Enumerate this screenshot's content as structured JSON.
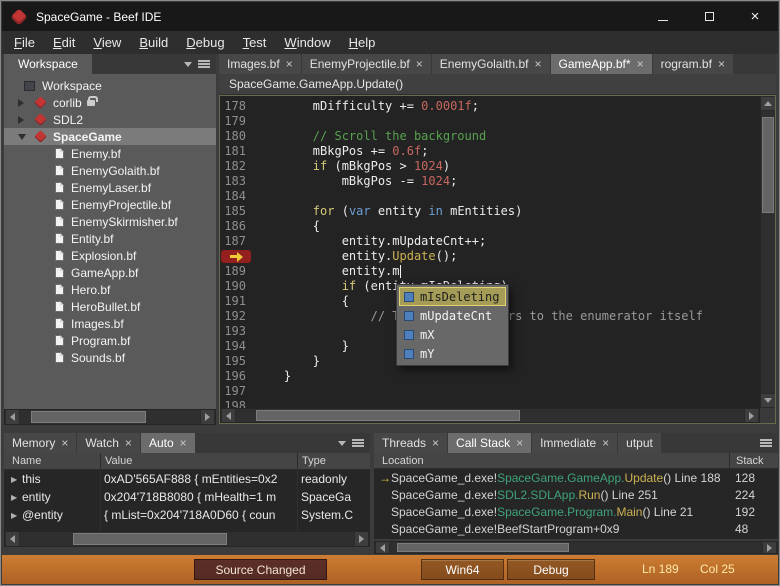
{
  "window": {
    "title": "SpaceGame - Beef IDE"
  },
  "menu": [
    "File",
    "Edit",
    "View",
    "Build",
    "Debug",
    "Test",
    "Window",
    "Help"
  ],
  "workspace": {
    "tab": "Workspace",
    "tree": [
      {
        "label": "Workspace",
        "icon": "workspace",
        "depth": 0
      },
      {
        "label": "corlib",
        "icon": "beef",
        "depth": 1,
        "arrow": "right",
        "lock": true
      },
      {
        "label": "SDL2",
        "icon": "beef",
        "depth": 1,
        "arrow": "right"
      },
      {
        "label": "SpaceGame",
        "icon": "beef",
        "depth": 1,
        "arrow": "down",
        "selected": true
      },
      {
        "label": "Enemy.bf",
        "icon": "file",
        "depth": 2
      },
      {
        "label": "EnemyGolaith.bf",
        "icon": "file",
        "depth": 2
      },
      {
        "label": "EnemyLaser.bf",
        "icon": "file",
        "depth": 2
      },
      {
        "label": "EnemyProjectile.bf",
        "icon": "file",
        "depth": 2
      },
      {
        "label": "EnemySkirmisher.bf",
        "icon": "file",
        "depth": 2
      },
      {
        "label": "Entity.bf",
        "icon": "file",
        "depth": 2
      },
      {
        "label": "Explosion.bf",
        "icon": "file",
        "depth": 2
      },
      {
        "label": "GameApp.bf",
        "icon": "file",
        "depth": 2
      },
      {
        "label": "Hero.bf",
        "icon": "file",
        "depth": 2
      },
      {
        "label": "HeroBullet.bf",
        "icon": "file",
        "depth": 2
      },
      {
        "label": "Images.bf",
        "icon": "file",
        "depth": 2
      },
      {
        "label": "Program.bf",
        "icon": "file",
        "depth": 2
      },
      {
        "label": "Sounds.bf",
        "icon": "file",
        "depth": 2
      }
    ]
  },
  "editor": {
    "tabs": [
      {
        "label": "Images.bf",
        "close": true
      },
      {
        "label": "EnemyProjectile.bf",
        "close": true
      },
      {
        "label": "EnemyGolaith.bf",
        "close": true
      },
      {
        "label": "GameApp.bf*",
        "close": true,
        "active": true
      },
      {
        "label": "rogram.bf",
        "close": true
      }
    ],
    "breadcrumb": "SpaceGame.GameApp.Update()",
    "ip_line": 188,
    "caret_line": 189,
    "lines": [
      {
        "num": 178,
        "segs": [
          [
            "p",
            "        mDifficulty += "
          ],
          [
            "n",
            "0.0001f"
          ],
          [
            "p",
            ";"
          ]
        ]
      },
      {
        "num": 179,
        "segs": []
      },
      {
        "num": 180,
        "segs": [
          [
            "c",
            "        // Scroll the background"
          ]
        ]
      },
      {
        "num": 181,
        "segs": [
          [
            "p",
            "        mBkgPos += "
          ],
          [
            "n",
            "0.6f"
          ],
          [
            "p",
            ";"
          ]
        ]
      },
      {
        "num": 182,
        "segs": [
          [
            "k",
            "        if"
          ],
          [
            "p",
            " (mBkgPos > "
          ],
          [
            "n",
            "1024"
          ],
          [
            "p",
            ")"
          ]
        ]
      },
      {
        "num": 183,
        "segs": [
          [
            "p",
            "            mBkgPos -= "
          ],
          [
            "n",
            "1024"
          ],
          [
            "p",
            ";"
          ]
        ]
      },
      {
        "num": 184,
        "segs": []
      },
      {
        "num": 185,
        "segs": [
          [
            "k",
            "        for"
          ],
          [
            "p",
            " ("
          ],
          [
            "t",
            "var"
          ],
          [
            "p",
            " entity "
          ],
          [
            "t",
            "in"
          ],
          [
            "p",
            " mEntities)"
          ]
        ]
      },
      {
        "num": 186,
        "segs": [
          [
            "p",
            "        {"
          ]
        ]
      },
      {
        "num": 187,
        "segs": [
          [
            "p",
            "            entity.mUpdateCnt++;"
          ]
        ]
      },
      {
        "num": 188,
        "segs": [
          [
            "p",
            "            entity."
          ],
          [
            "m",
            "Update"
          ],
          [
            "p",
            "();"
          ]
        ]
      },
      {
        "num": 189,
        "segs": [
          [
            "p",
            "            entity.m"
          ]
        ]
      },
      {
        "num": 190,
        "segs": [
          [
            "k",
            "            if"
          ],
          [
            "p",
            " (entity.mIsDeleting)"
          ]
        ]
      },
      {
        "num": 191,
        "segs": [
          [
            "p",
            "            {"
          ]
        ]
      },
      {
        "num": 192,
        "segs": [
          [
            "g",
            "                // The @entity refers to the enumerator itself"
          ]
        ]
      },
      {
        "num": 193,
        "segs": []
      },
      {
        "num": 194,
        "segs": [
          [
            "p",
            "            }"
          ]
        ]
      },
      {
        "num": 195,
        "segs": [
          [
            "p",
            "        }"
          ]
        ]
      },
      {
        "num": 196,
        "segs": [
          [
            "p",
            "    }"
          ]
        ]
      },
      {
        "num": 197,
        "segs": []
      },
      {
        "num": 198,
        "segs": []
      }
    ],
    "autocomplete": {
      "items": [
        {
          "label": "mIsDeleting",
          "selected": true
        },
        {
          "label": "mUpdateCnt"
        },
        {
          "label": "mX"
        },
        {
          "label": "mY"
        }
      ]
    }
  },
  "watch": {
    "tabs": [
      {
        "label": "Memory",
        "close": true
      },
      {
        "label": "Watch",
        "close": true
      },
      {
        "label": "Auto",
        "close": true,
        "active": true
      }
    ],
    "columns": [
      "Name",
      "Value",
      "Type"
    ],
    "rows": [
      {
        "name": "this",
        "value": "0xAD'565AF888 { mEntities=0x2",
        "type": "readonly"
      },
      {
        "name": "entity",
        "value": "0x204'718B8080 { mHealth=1 m",
        "type": "SpaceGa"
      },
      {
        "name": "@entity",
        "value": "{ mList=0x204'718A0D60 { coun",
        "type": "System.C"
      }
    ]
  },
  "callstack": {
    "tabs": [
      {
        "label": "Threads",
        "close": true
      },
      {
        "label": "Call Stack",
        "close": true,
        "active": true
      },
      {
        "label": "Immediate",
        "close": true
      },
      {
        "label": "utput",
        "close": false
      }
    ],
    "columns": [
      "Location",
      "Stack"
    ],
    "frames": [
      {
        "current": true,
        "loc": [
          [
            "p",
            "SpaceGame_d.exe!"
          ],
          [
            "ns",
            "SpaceGame.GameApp."
          ],
          [
            "fn",
            "Update"
          ],
          [
            "p",
            "() Line 188"
          ]
        ],
        "stack": "128"
      },
      {
        "loc": [
          [
            "p",
            "SpaceGame_d.exe!"
          ],
          [
            "ns",
            "SDL2.SDLApp."
          ],
          [
            "fn",
            "Run"
          ],
          [
            "p",
            "() Line 251"
          ]
        ],
        "stack": "224"
      },
      {
        "loc": [
          [
            "p",
            "SpaceGame_d.exe!"
          ],
          [
            "ns",
            "SpaceGame.Program."
          ],
          [
            "fn",
            "Main"
          ],
          [
            "p",
            "() Line 21"
          ]
        ],
        "stack": "192"
      },
      {
        "loc": [
          [
            "p",
            "SpaceGame_d.exe!BeefStartProgram+0x9"
          ]
        ],
        "stack": "48"
      }
    ]
  },
  "statusbar": {
    "source_changed": "Source Changed",
    "platform": "Win64",
    "config": "Debug",
    "line": "Ln 189",
    "col": "Col 25"
  },
  "colors": {
    "statusbar_orange": "#cd7d33",
    "statusbar_orange_dark": "#ad6124",
    "source_changed_bg": "#542b24",
    "keyword": "#d6c97a",
    "type_keyword": "#6f9fd6",
    "number": "#c7685f",
    "comment": "#57a24f",
    "method": "#cdb152",
    "ghost": "#9a9a9a",
    "callstack_ns": "#3fa379",
    "callstack_fn": "#cdb152",
    "ip_red": "#941f1f",
    "ip_yellow": "#eecb36",
    "selection_bg": "#a59d57",
    "selection_border": "#e0d36d",
    "beef_red": "#c23535",
    "field_icon_blue": "#4d80bd",
    "status_lncol": "#ffe9a8"
  }
}
